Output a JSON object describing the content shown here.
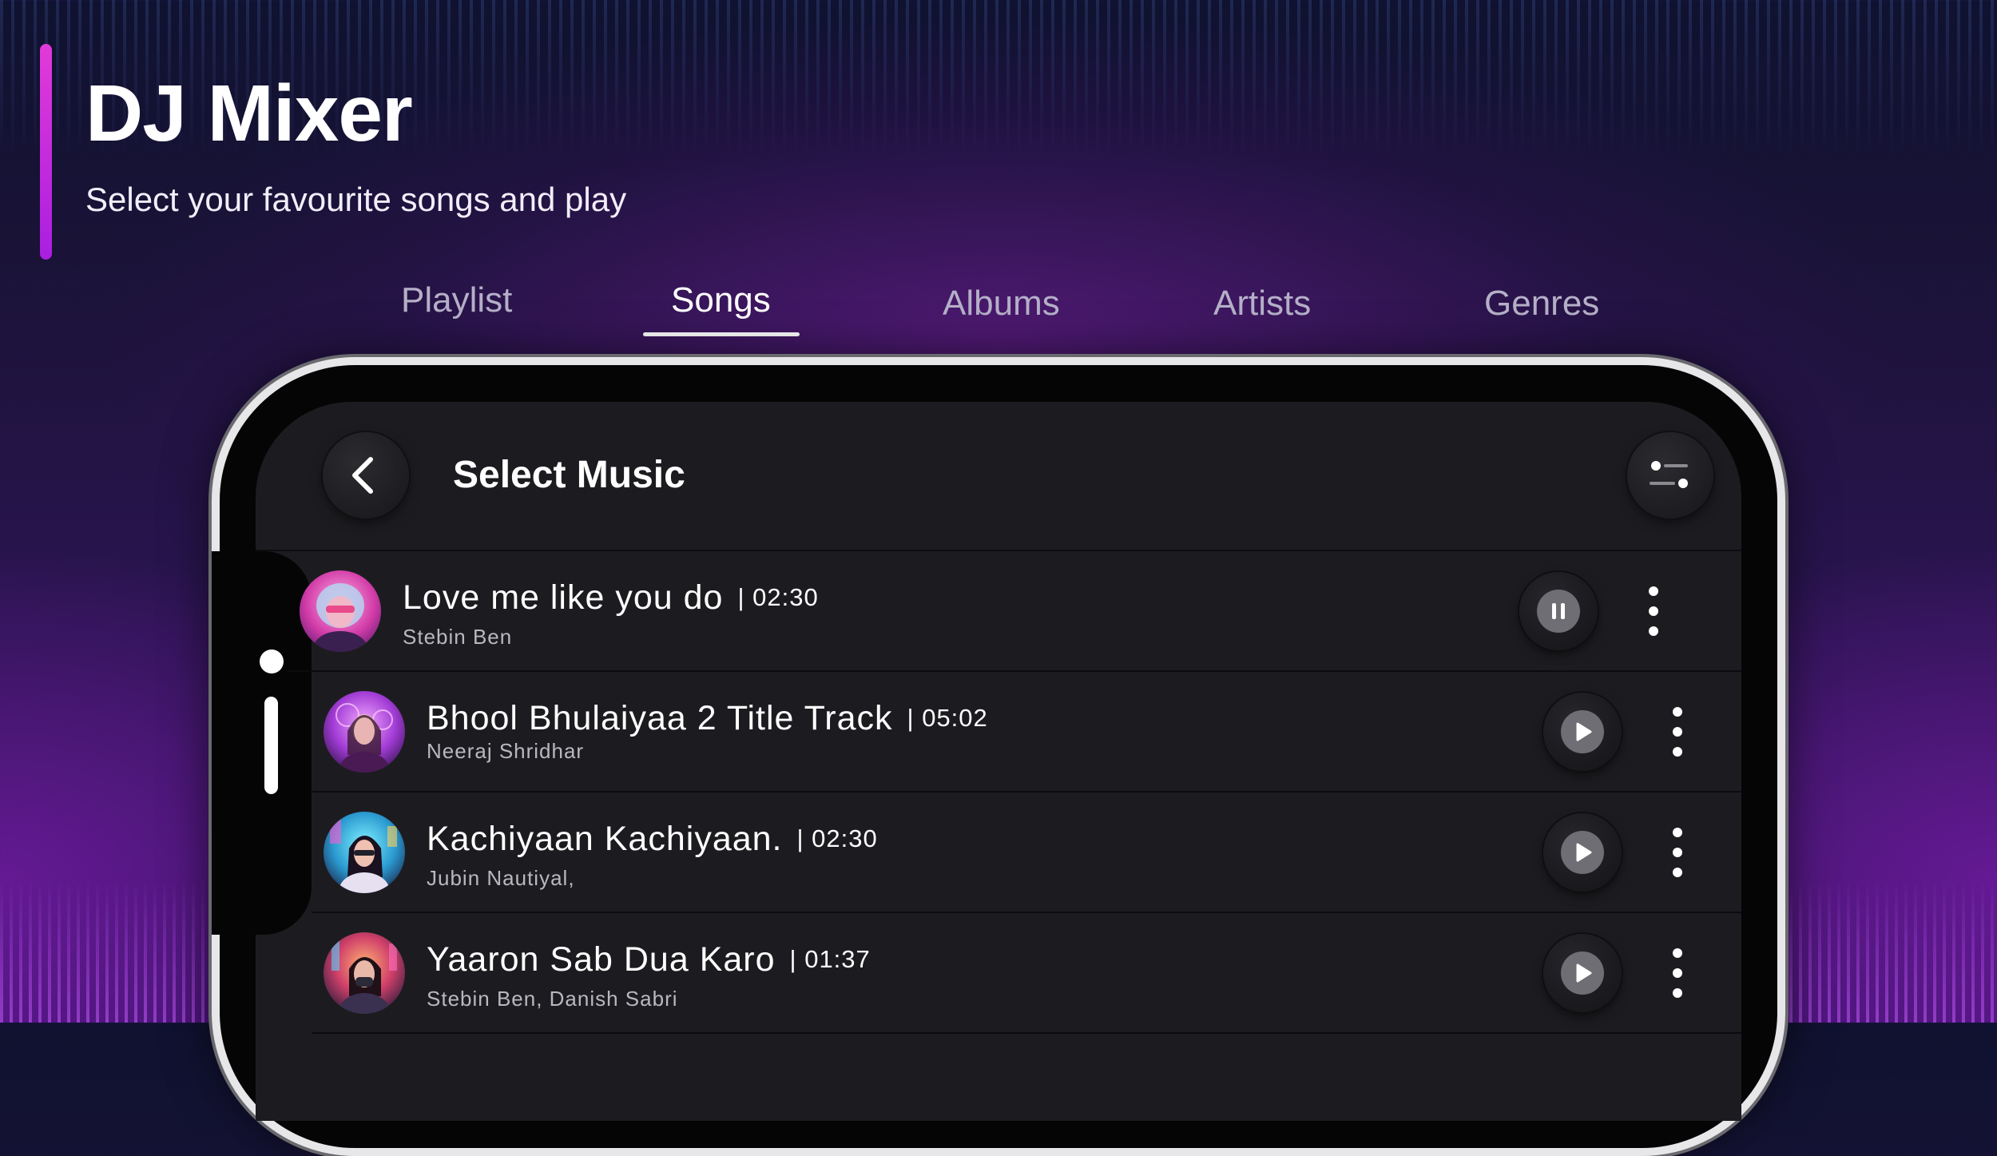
{
  "header": {
    "title": "DJ Mixer",
    "subtitle": "Select your favourite songs and play"
  },
  "tabs": [
    {
      "label": "Playlist"
    },
    {
      "label": "Songs"
    },
    {
      "label": "Albums"
    },
    {
      "label": "Artists"
    },
    {
      "label": "Genres"
    }
  ],
  "active_tab": "Songs",
  "screen": {
    "title": "Select Music"
  },
  "songs": [
    {
      "title": "Love me like you do",
      "duration": "| 02:30",
      "artist": "Stebin Ben",
      "state": "playing"
    },
    {
      "title": "Bhool Bhulaiyaa 2 Title Track",
      "duration": "| 05:02",
      "artist": "Neeraj Shridhar",
      "state": "paused"
    },
    {
      "title": "Kachiyaan Kachiyaan.",
      "duration": "| 02:30",
      "artist": "Jubin Nautiyal,",
      "state": "paused"
    },
    {
      "title": "Yaaron Sab Dua Karo",
      "duration": "| 01:37",
      "artist": "Stebin Ben, Danish Sabri",
      "state": "paused"
    }
  ],
  "icons": {
    "back": "chevron-left-icon",
    "filter": "sliders-icon",
    "pause": "pause-icon",
    "play": "play-icon",
    "more": "more-vertical-icon"
  },
  "colors": {
    "accent": "#c62fe0",
    "screen_bg": "#1c1c20",
    "phone_frame": "#e7e7ea"
  }
}
